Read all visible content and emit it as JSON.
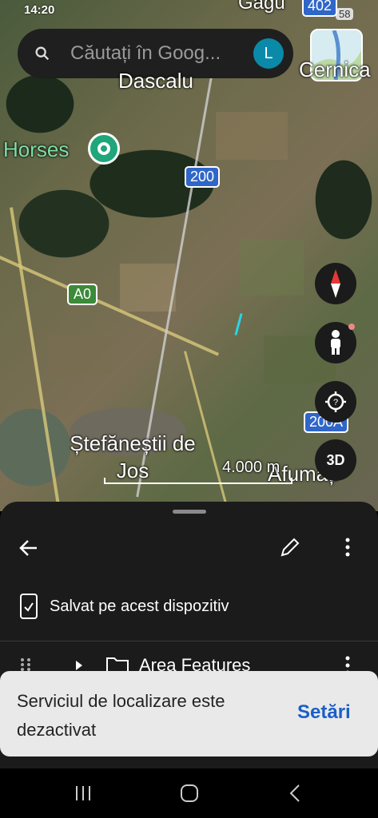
{
  "status_bar": {
    "time": "14:20",
    "badge": "58"
  },
  "search": {
    "placeholder": "Căutați în Goog...",
    "avatar_letter": "L"
  },
  "map": {
    "labels": {
      "top_place": "Dascalu",
      "top_right_place": "Cernica",
      "poi": "Horses",
      "town": "Ștefăneștii de Jos",
      "town_right": "Afumați",
      "top_road_text": "Găgu"
    },
    "shields": {
      "road_402": "402",
      "road_200": "200",
      "road_a0": "A0",
      "road_200a": "200A"
    },
    "scale_text": "4.000 m",
    "buttons": {
      "three_d": "3D"
    }
  },
  "sheet": {
    "saved_text": "Salvat pe acest dispozitiv",
    "folder_label": "Area Features"
  },
  "snackbar": {
    "message": "Serviciul de localizare este dezactivat",
    "action": "Setări"
  }
}
